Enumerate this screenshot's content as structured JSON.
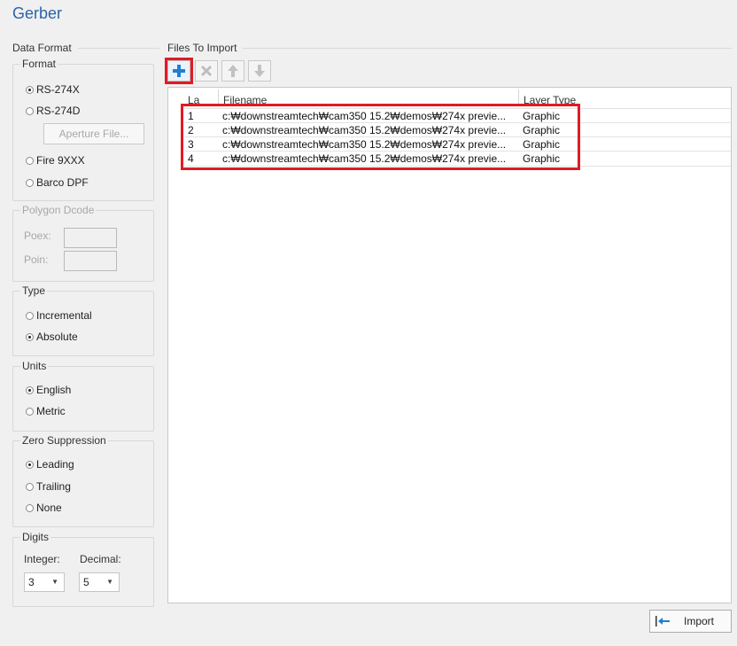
{
  "window": {
    "title": "Gerber"
  },
  "data_format": {
    "label": "Data Format",
    "format": {
      "legend": "Format",
      "options": [
        {
          "label": "RS-274X",
          "selected": true
        },
        {
          "label": "RS-274D",
          "selected": false
        },
        {
          "label": "Fire 9XXX",
          "selected": false
        },
        {
          "label": "Barco DPF",
          "selected": false
        }
      ],
      "aperture_button": "Aperture File..."
    },
    "polygon_dcode": {
      "legend": "Polygon Dcode",
      "poex_label": "Poex:",
      "poin_label": "Poin:"
    },
    "type": {
      "legend": "Type",
      "options": [
        {
          "label": "Incremental",
          "selected": false
        },
        {
          "label": "Absolute",
          "selected": true
        }
      ]
    },
    "units": {
      "legend": "Units",
      "options": [
        {
          "label": "English",
          "selected": true
        },
        {
          "label": "Metric",
          "selected": false
        }
      ]
    },
    "zero_suppression": {
      "legend": "Zero Suppression",
      "options": [
        {
          "label": "Leading",
          "selected": true
        },
        {
          "label": "Trailing",
          "selected": false
        },
        {
          "label": "None",
          "selected": false
        }
      ]
    },
    "digits": {
      "legend": "Digits",
      "integer_label": "Integer:",
      "integer_value": "3",
      "decimal_label": "Decimal:",
      "decimal_value": "5"
    }
  },
  "files": {
    "label": "Files To Import",
    "toolbar": {
      "add_icon": "plus-icon",
      "remove_icon": "x-icon",
      "up_icon": "arrow-up-icon",
      "down_icon": "arrow-down-icon"
    },
    "columns": [
      "La",
      "Filename",
      "Layer Type"
    ],
    "rows": [
      {
        "num": "1",
        "filename": "c:₩downstreamtech₩cam350 15.2₩demos₩274x previe...",
        "type": "Graphic"
      },
      {
        "num": "2",
        "filename": "c:₩downstreamtech₩cam350 15.2₩demos₩274x previe...",
        "type": "Graphic"
      },
      {
        "num": "3",
        "filename": "c:₩downstreamtech₩cam350 15.2₩demos₩274x previe...",
        "type": "Graphic"
      },
      {
        "num": "4",
        "filename": "c:₩downstreamtech₩cam350 15.2₩demos₩274x previe...",
        "type": "Graphic"
      }
    ]
  },
  "import_button": {
    "label": "Import",
    "icon": "import-icon"
  },
  "colors": {
    "accent": "#2b63a8",
    "highlight": "#e01b24",
    "add_icon": "#1e7fd0"
  }
}
